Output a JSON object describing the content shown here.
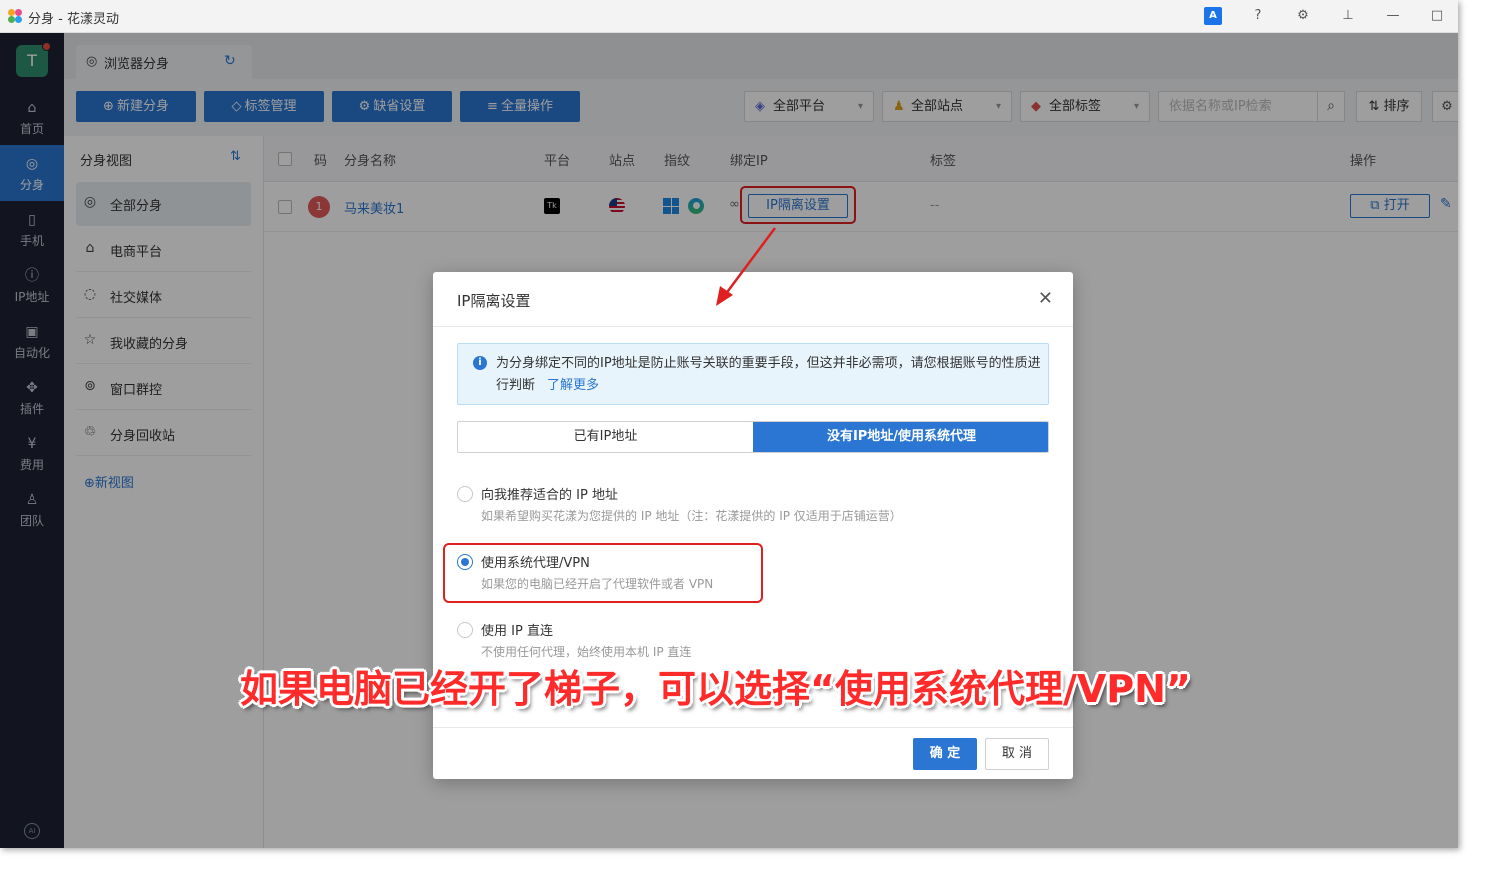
{
  "window": {
    "title": "分身 - 花漾灵动"
  },
  "nav": {
    "avatar_letter": "T",
    "items": [
      {
        "label": "首页",
        "icon": "home-icon"
      },
      {
        "label": "分身",
        "icon": "browser-icon"
      },
      {
        "label": "手机",
        "icon": "phone-icon"
      },
      {
        "label": "IP地址",
        "icon": "ip-icon"
      },
      {
        "label": "自动化",
        "icon": "robot-icon"
      },
      {
        "label": "插件",
        "icon": "plugin-icon"
      },
      {
        "label": "费用",
        "icon": "yen-icon"
      },
      {
        "label": "团队",
        "icon": "team-icon"
      }
    ],
    "ai_label": "AI"
  },
  "tab": {
    "label": "浏览器分身"
  },
  "toolbar": {
    "new_label": "新建分身",
    "tags_label": "标签管理",
    "defaults_label": "缺省设置",
    "bulk_label": "全量操作",
    "platform_label": "全部平台",
    "site_label": "全部站点",
    "tag_filter_label": "全部标签",
    "search_placeholder": "依据名称或IP检索",
    "sort_label": "排序"
  },
  "views": {
    "title": "分身视图",
    "items": [
      {
        "label": "全部分身"
      },
      {
        "label": "电商平台"
      },
      {
        "label": "社交媒体"
      },
      {
        "label": "我收藏的分身"
      },
      {
        "label": "窗口群控"
      },
      {
        "label": "分身回收站"
      }
    ],
    "new_view_label": "新视图"
  },
  "table": {
    "columns": [
      "码",
      "分身名称",
      "平台",
      "站点",
      "指纹",
      "绑定IP",
      "标签",
      "操作"
    ],
    "rows": [
      {
        "number": "1",
        "name": "马来美妆1",
        "platform_badge": "Tk",
        "ip_button": "IP隔离设置",
        "tags": "--",
        "open_label": "打开"
      }
    ]
  },
  "modal": {
    "title": "IP隔离设置",
    "info_text": "为分身绑定不同的IP地址是防止账号关联的重要手段，但这并非必需项，请您根据账号的性质进行判断",
    "info_link": "了解更多",
    "segment_a": "已有IP地址",
    "segment_b": "没有IP地址/使用系统代理",
    "options": [
      {
        "label": "向我推荐适合的 IP 地址",
        "desc": "如果希望购买花漾为您提供的 IP 地址（注：花漾提供的 IP 仅适用于店铺运营）",
        "checked": false
      },
      {
        "label": "使用系统代理/VPN",
        "desc": "如果您的电脑已经开启了代理软件或者 VPN",
        "checked": true
      },
      {
        "label": "使用 IP 直连",
        "desc": "不使用任何代理，始终使用本机 IP 直连",
        "checked": false
      }
    ],
    "ok_label": "确 定",
    "cancel_label": "取 消"
  },
  "annotation": {
    "caption": "如果电脑已经开了梯子，可以选择“使用系统代理/VPN”",
    "highlight_color": "#e02020"
  },
  "colors": {
    "accent": "#2a76d2",
    "nav_bg": "#1e2233"
  }
}
